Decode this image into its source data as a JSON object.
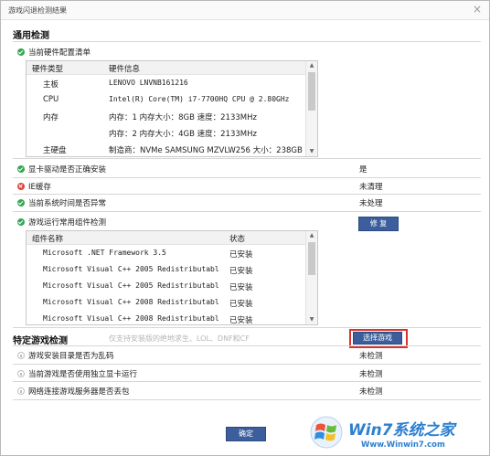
{
  "window": {
    "title": "游戏闪退检测结果",
    "close": "×"
  },
  "general": {
    "title": "通用检测",
    "hardware": {
      "label": "当前硬件配置清单",
      "headers": [
        "硬件类型",
        "硬件信息"
      ],
      "rows": [
        {
          "type": "主板",
          "info": "LENOVO LNVNB161216"
        },
        {
          "type": "CPU",
          "info": "Intel(R) Core(TM) i7-7700HQ CPU @ 2.80GHz"
        },
        {
          "type": "内存",
          "info": "内存：1 内存大小：8GB 速度：2133MHz"
        },
        {
          "type": "",
          "info": "内存：2 内存大小：4GB 速度：2133MHz"
        },
        {
          "type": "主硬盘",
          "info": "制造商：NVMe SAMSUNG MZVLW256 大小：238GB"
        }
      ]
    },
    "checks": [
      {
        "label": "显卡驱动是否正确安装",
        "value": "是",
        "status": "ok"
      },
      {
        "label": "IE缓存",
        "value": "未清理",
        "status": "error"
      },
      {
        "label": "当前系统时间是否异常",
        "value": "未处理",
        "status": "ok"
      }
    ],
    "components": {
      "label": "游戏运行常用组件检测",
      "repair_button": "修 复",
      "headers": [
        "组件名称",
        "状态"
      ],
      "rows": [
        {
          "name": "Microsoft .NET Framework 3.5",
          "status": "已安装"
        },
        {
          "name": "Microsoft Visual C++ 2005 Redistributabl",
          "status": "已安装"
        },
        {
          "name": "Microsoft Visual C++ 2005 Redistributabl",
          "status": "已安装"
        },
        {
          "name": "Microsoft Visual C++ 2008 Redistributabl",
          "status": "已安装"
        },
        {
          "name": "Microsoft Visual C++ 2008 Redistributabl",
          "status": "已安装"
        }
      ]
    }
  },
  "specific": {
    "title": "特定游戏检测",
    "hint": "仅支持安装版的绝地求生、LOL、DNF和CF",
    "select_button": "选择游戏",
    "checks": [
      {
        "label": "游戏安装目录是否为乱码",
        "value": "未检测"
      },
      {
        "label": "当前游戏是否使用独立显卡运行",
        "value": "未检测"
      },
      {
        "label": "网络连接游戏服务器是否丢包",
        "value": "未检测"
      }
    ]
  },
  "ok_button": "确定",
  "watermark": {
    "brand": "Win7系统之家",
    "url": "Www.Winwin7.com"
  },
  "colors": {
    "ok": "#34a853",
    "error": "#e0433b",
    "button": "#3c5e9c",
    "highlight": "#d9342b"
  }
}
